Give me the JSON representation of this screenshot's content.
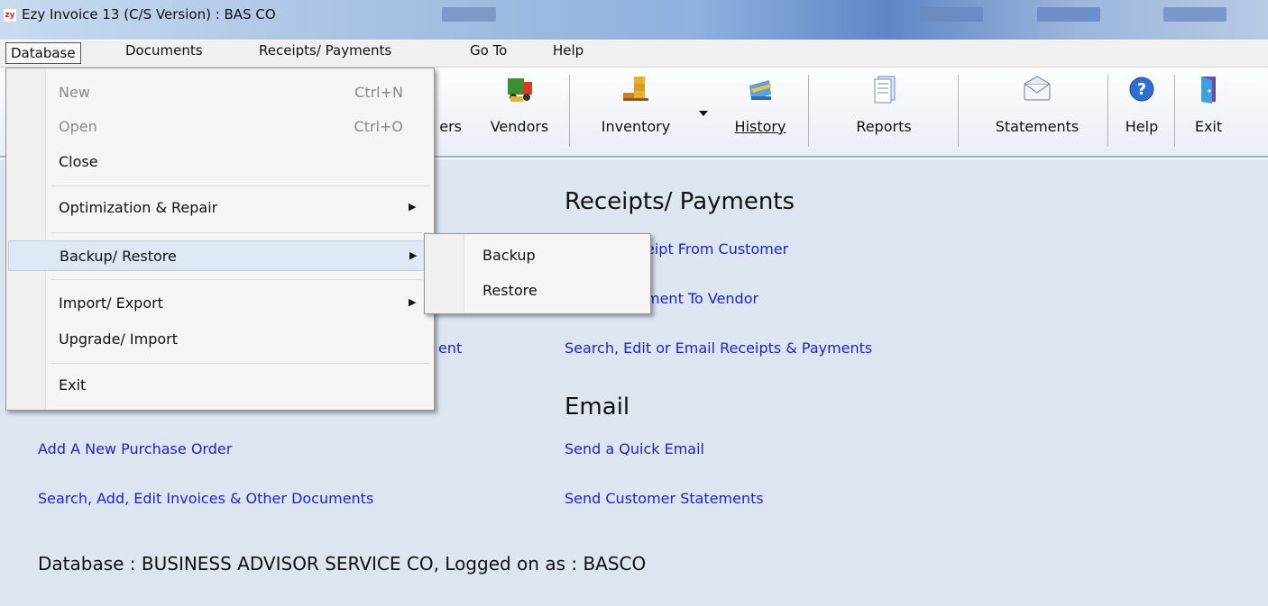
{
  "window": {
    "title": "Ezy Invoice 13 (C/S Version)  : BAS CO",
    "icon_text": "zy"
  },
  "menubar": [
    "Database",
    "Documents",
    "Receipts/ Payments",
    "Go To",
    "Help"
  ],
  "toolbar": {
    "partial_customers": "ers",
    "vendors": "Vendors",
    "inventory": "Inventory",
    "history": "History",
    "reports": "Reports",
    "statements": "Statements",
    "help": "Help",
    "exit": "Exit"
  },
  "database_menu": {
    "new": {
      "label": "New",
      "shortcut": "Ctrl+N"
    },
    "open": {
      "label": "Open",
      "shortcut": "Ctrl+O"
    },
    "close": "Close",
    "optimization": "Optimization & Repair",
    "backup_restore": "Backup/ Restore",
    "import_export": "Import/ Export",
    "upgrade_import": "Upgrade/ Import",
    "exit": "Exit"
  },
  "backup_submenu": {
    "backup": "Backup",
    "restore": "Restore"
  },
  "content": {
    "receipts_heading": "Receipts/ Payments",
    "receipt_from_customer": "eipt From Customer",
    "payment_to_vendor": "ment To Vendor",
    "partial_documents_link": "ent",
    "search_receipts": "Search, Edit or Email Receipts & Payments",
    "email_heading": "Email",
    "add_purchase_order": "Add A New Purchase Order",
    "send_quick_email": "Send a Quick Email",
    "search_invoices": "Search, Add, Edit Invoices & Other Documents",
    "send_statements": "Send Customer Statements",
    "status": "Database : BUSINESS ADVISOR SERVICE CO,  Logged on as : BASCO"
  },
  "colors": {
    "link": "#1c25c8",
    "content_bg": "#dde5f0",
    "menu_highlight": "#dce8f6"
  }
}
